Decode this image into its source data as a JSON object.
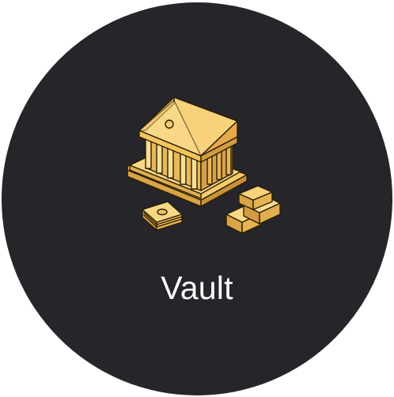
{
  "tile": {
    "label": "Vault",
    "icon": "bank-building-icon",
    "background_color": "#262529",
    "accent_color": "#F2C45C"
  },
  "illustration": {
    "items": [
      "bank-building-icon",
      "cash-stack-icon",
      "gold-bars-icon"
    ]
  }
}
